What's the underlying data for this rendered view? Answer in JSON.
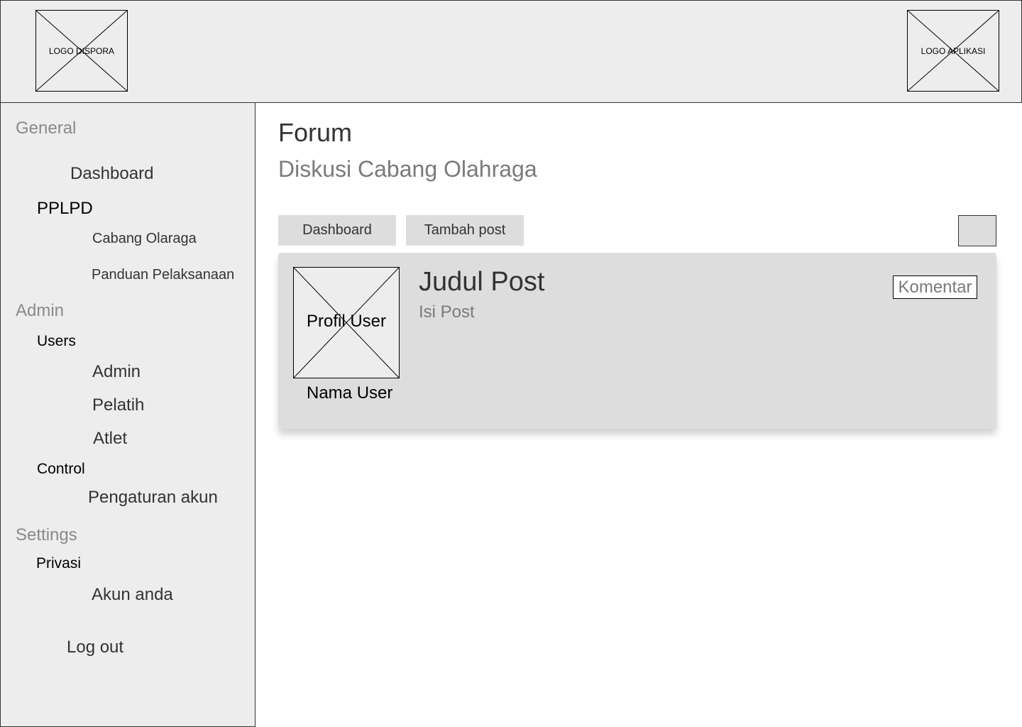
{
  "header": {
    "logo_left": "LOGO DISPORA",
    "logo_right": "LOGO APLIKASI"
  },
  "sidebar": {
    "general": "General",
    "dashboard": "Dashboard",
    "pplpd": "PPLPD",
    "cabang_olaraga": "Cabang Olaraga",
    "panduan_pelaksanaan": "Panduan Pelaksanaan",
    "admin_section": "Admin",
    "users": "Users",
    "admin": "Admin",
    "pelatih": "Pelatih",
    "atlet": "Atlet",
    "control": "Control",
    "pengaturan_akun": "Pengaturan akun",
    "settings": "Settings",
    "privasi": "Privasi",
    "akun_anda": "Akun anda",
    "logout": "Log out"
  },
  "main": {
    "title": "Forum",
    "subtitle": "Diskusi Cabang Olahraga",
    "toolbar": {
      "dashboard_label": "Dashboard",
      "add_post_label": "Tambah post"
    },
    "post": {
      "profile_label": "Profil User",
      "user_name": "Nama User",
      "title": "Judul Post",
      "body": "Isi Post",
      "comment_label": "Komentar"
    }
  }
}
